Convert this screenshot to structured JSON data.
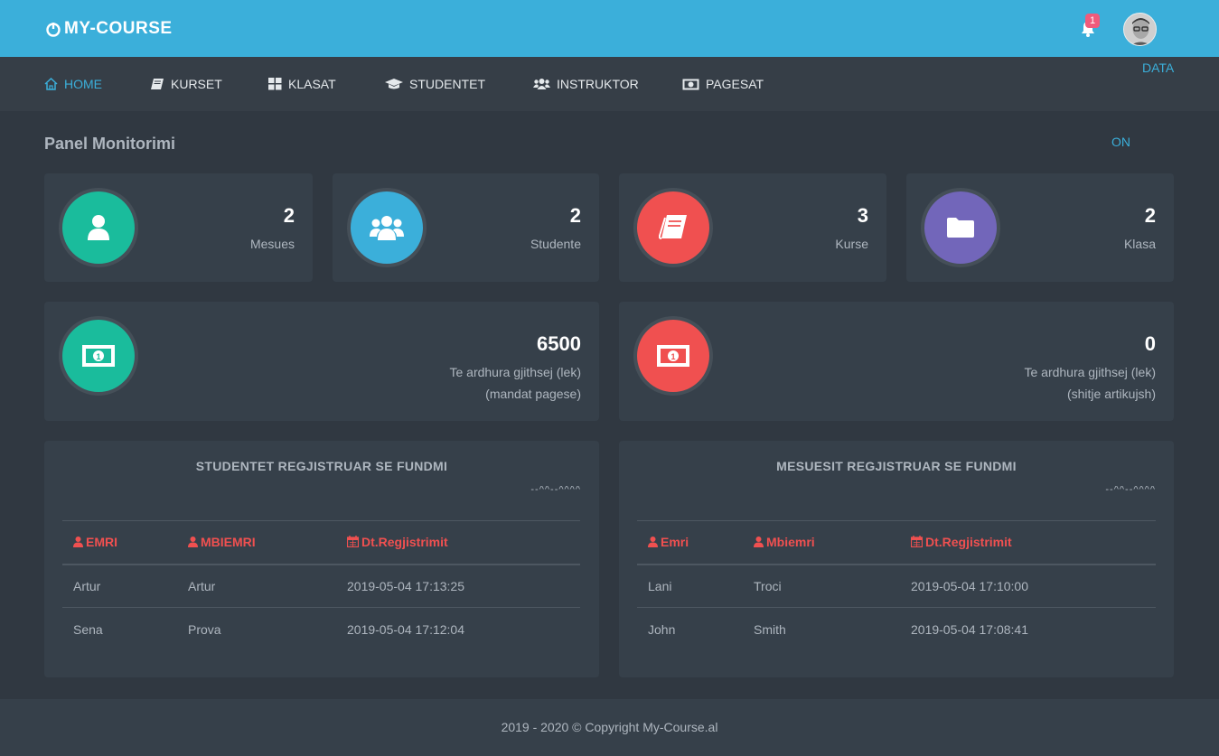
{
  "app": {
    "brand": "MY-COURSE",
    "notifications": "1"
  },
  "nav": {
    "home": "HOME",
    "kurset": "KURSET",
    "klasat": "KLASAT",
    "studentet": "STUDENTET",
    "instruktor": "INSTRUKTOR",
    "pagesat": "PAGESAT",
    "data": "DATA"
  },
  "page": {
    "title": "Panel Monitorimi",
    "on_link": "ON"
  },
  "stats": [
    {
      "value": "2",
      "label": "Mesues",
      "color": "#1abc9c"
    },
    {
      "value": "2",
      "label": "Studente",
      "color": "#3bafda"
    },
    {
      "value": "3",
      "label": "Kurse",
      "color": "#f05050"
    },
    {
      "value": "2",
      "label": "Klasa",
      "color": "#7266ba"
    }
  ],
  "income": [
    {
      "value": "6500",
      "label": "Te ardhura gjithsej (lek)",
      "sub": "(mandat pagese)",
      "color": "#1abc9c"
    },
    {
      "value": "0",
      "label": "Te ardhura gjithsej (lek)",
      "sub": "(shitje artikujsh)",
      "color": "#f05050"
    }
  ],
  "students_table": {
    "title": "STUDENTET REGJISTRUAR SE FUNDMI",
    "sparkline": "--^^--^^^^",
    "headers": [
      "EMRI",
      "MBIEMRI",
      "Dt.Regjistrimit"
    ],
    "rows": [
      [
        "Artur",
        "Artur",
        "2019-05-04 17:13:25"
      ],
      [
        "Sena",
        "Prova",
        "2019-05-04 17:12:04"
      ]
    ]
  },
  "teachers_table": {
    "title": "MESUESIT REGJISTRUAR SE FUNDMI",
    "sparkline": "--^^--^^^^",
    "headers": [
      "Emri",
      "Mbiemri",
      "Dt.Regjistrimit"
    ],
    "rows": [
      [
        "Lani",
        "Troci",
        "2019-05-04 17:10:00"
      ],
      [
        "John",
        "Smith",
        "2019-05-04 17:08:41"
      ]
    ]
  },
  "footer": "2019 - 2020 © Copyright My-Course.al"
}
